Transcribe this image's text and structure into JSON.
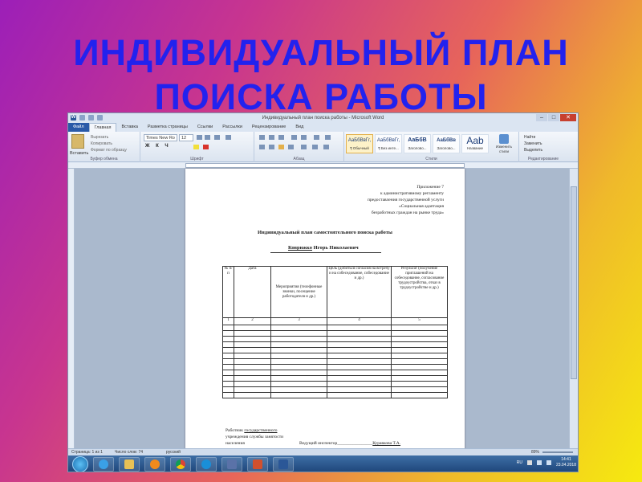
{
  "slide_title": {
    "line1": "ИНДИВИДУАЛЬНЫЙ ПЛАН",
    "line2": "ПОИСКА РАБОТЫ"
  },
  "window": {
    "title": "Индивидуальный план поиска работы - Microsoft Word",
    "tabs": [
      "Файл",
      "Главная",
      "Вставка",
      "Разметка страницы",
      "Ссылки",
      "Рассылки",
      "Рецензирование",
      "Вид"
    ],
    "active_tab": "Главная"
  },
  "ribbon": {
    "clipboard": {
      "paste": "Вставить",
      "cut": "Вырезать",
      "copy": "Копировать",
      "format": "Формат по образцу",
      "label": "Буфер обмена"
    },
    "font": {
      "name": "Times New Ro",
      "size": "12",
      "label": "Шрифт"
    },
    "paragraph_label": "Абзац",
    "styles": [
      {
        "sample": "АаБбВвГг,",
        "name": "¶ Обычный"
      },
      {
        "sample": "АаБбВвГг,",
        "name": "¶ Без инте..."
      },
      {
        "sample": "АаБбВ",
        "name": "Заголово..."
      },
      {
        "sample": "АаБбВв",
        "name": "Заголово..."
      },
      {
        "sample": "Aab",
        "name": "Название"
      }
    ],
    "change_styles": "Изменить стили",
    "styles_label": "Стили",
    "editing": {
      "find": "Найти",
      "replace": "Заменить",
      "select": "Выделить",
      "label": "Редактирование"
    }
  },
  "document": {
    "appendix": [
      "Приложение 7",
      "к административному регламенту",
      "предоставления государственной услуги",
      "«Социальная адаптация",
      "безработных граждан на рынке труда»"
    ],
    "heading": "Индивидуальный план самостоятельного поиска работы",
    "person_surname": "Коврижко",
    "person_rest": " Игорь Николаевич",
    "table": {
      "headers": [
        "№ п/п",
        "Дата",
        "Мероприятия (телефонные звонки, посещение работодателя и др.)",
        "Цель (добиться согласия на встречу и на собеседование, собеседование и др.)",
        "Результат (получение приглашений на собеседование, согласование трудоустройства, отказ в трудоустройстве и др.)"
      ],
      "numbers": [
        "1",
        "2",
        "3",
        "4",
        "5"
      ]
    },
    "footer": {
      "line1_a": "Работник ",
      "line1_b": "государственного",
      "line2": "учреждения службы занятости",
      "line3": "населения",
      "right_prefix": "Ведущий инспектор________________",
      "inspector": "Куравкова Т.А."
    }
  },
  "status": {
    "page": "Страница: 1 из 1",
    "words": "Число слов: 74",
    "lang": "русский",
    "zoom": "89%"
  },
  "taskbar": {
    "lang": "RU",
    "time": "14:41",
    "date": "23.04.2018"
  },
  "colors": {
    "title": "#2222ee",
    "file_tab": "#2a5aa8",
    "taskbar": "#1d4478"
  }
}
